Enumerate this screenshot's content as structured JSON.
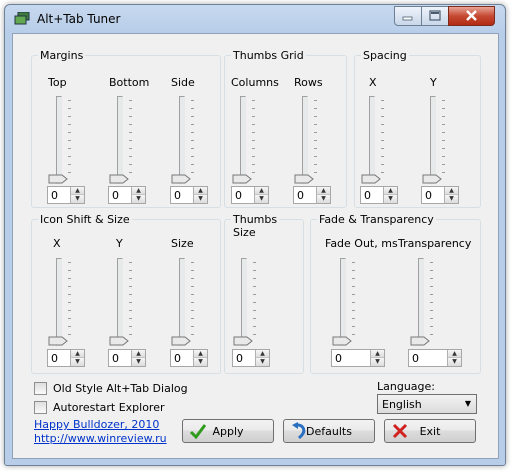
{
  "window": {
    "title": "Alt+Tab Tuner",
    "app_icon": "monitor-stack-icon"
  },
  "captions": {
    "minimize": "minimize-icon",
    "maximize": "maximize-icon",
    "close": "close-icon"
  },
  "groups": {
    "margins": {
      "title": "Margins",
      "labels": [
        "Top",
        "Bottom",
        "Side"
      ],
      "values": [
        "0",
        "0",
        "0"
      ]
    },
    "thumbs_grid": {
      "title": "Thumbs Grid",
      "labels": [
        "Columns",
        "Rows"
      ],
      "values": [
        "0",
        "0"
      ]
    },
    "spacing": {
      "title": "Spacing",
      "labels": [
        "X",
        "Y"
      ],
      "values": [
        "0",
        "0"
      ]
    },
    "icon_shift": {
      "title": "Icon Shift & Size",
      "labels": [
        "X",
        "Y",
        "Size"
      ],
      "values": [
        "0",
        "0",
        "0"
      ]
    },
    "thumbs_size": {
      "title": "Thumbs\nSize",
      "values": [
        "0"
      ]
    },
    "fade": {
      "title": "Fade & Transparency",
      "labels": [
        "Fade Out, ms",
        "Transparency"
      ],
      "values": [
        "0",
        "0"
      ]
    }
  },
  "options": {
    "old_style": "Old Style Alt+Tab Dialog",
    "autorestart": "Autorestart Explorer"
  },
  "language": {
    "label": "Language:",
    "selected": "English"
  },
  "credits": {
    "author": "Happy Bulldozer, 2010",
    "url": "http://www.winreview.ru"
  },
  "buttons": {
    "apply": "Apply",
    "defaults": "Defaults",
    "exit": "Exit"
  },
  "colors": {
    "apply_icon": "#2f9b1c",
    "defaults_icon": "#2a6fc1",
    "exit_icon": "#d02020",
    "link": "#0033cc"
  }
}
